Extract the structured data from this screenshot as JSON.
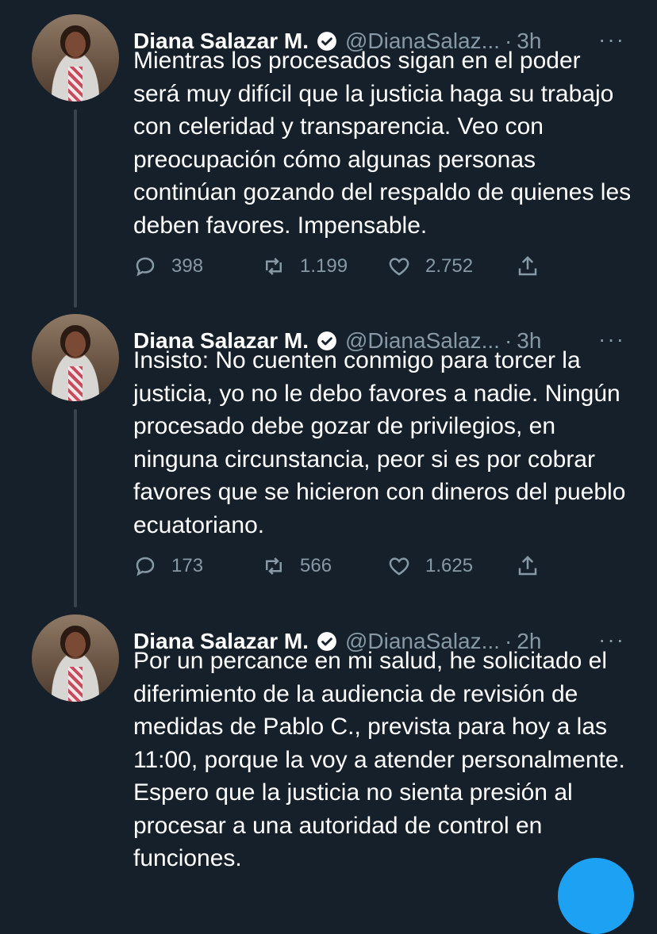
{
  "tweets": [
    {
      "name": "Diana Salazar M.",
      "handle": "@DianaSalaz...",
      "separator": "·",
      "time": "3h",
      "more": "···",
      "text": "Mientras los procesados sigan en el poder será muy difícil que la justicia haga su trabajo con celeridad y transparencia. Veo con preocupación cómo algunas personas continúan gozando del respaldo de quienes les deben favores. Impensable.",
      "replies": "398",
      "retweets": "1.199",
      "likes": "2.752"
    },
    {
      "name": "Diana Salazar M.",
      "handle": "@DianaSalaz...",
      "separator": "·",
      "time": "3h",
      "more": "···",
      "text": "Insisto: No cuenten conmigo para torcer la justicia, yo no le debo favores a nadie. Ningún procesado debe gozar de privilegios, en ninguna circunstancia, peor si es por cobrar favores que se hicieron con dineros del pueblo ecuatoriano.",
      "replies": "173",
      "retweets": "566",
      "likes": "1.625"
    },
    {
      "name": "Diana Salazar M.",
      "handle": "@DianaSalaz...",
      "separator": "·",
      "time": "2h",
      "more": "···",
      "text": "Por un percance en mi salud, he solicitado el diferimiento de la audiencia de revisión de medidas de Pablo C., prevista para hoy a las 11:00, porque la voy a atender personalmente. Espero que la justicia no sienta presión al procesar a una autoridad de control en funciones."
    }
  ],
  "icons": {
    "verified": "verified-badge-icon",
    "reply": "reply-icon",
    "retweet": "retweet-icon",
    "like": "heart-icon",
    "share": "share-icon"
  },
  "colors": {
    "background": "#15202b",
    "secondary_text": "#8899a6",
    "accent": "#1da1f2"
  }
}
